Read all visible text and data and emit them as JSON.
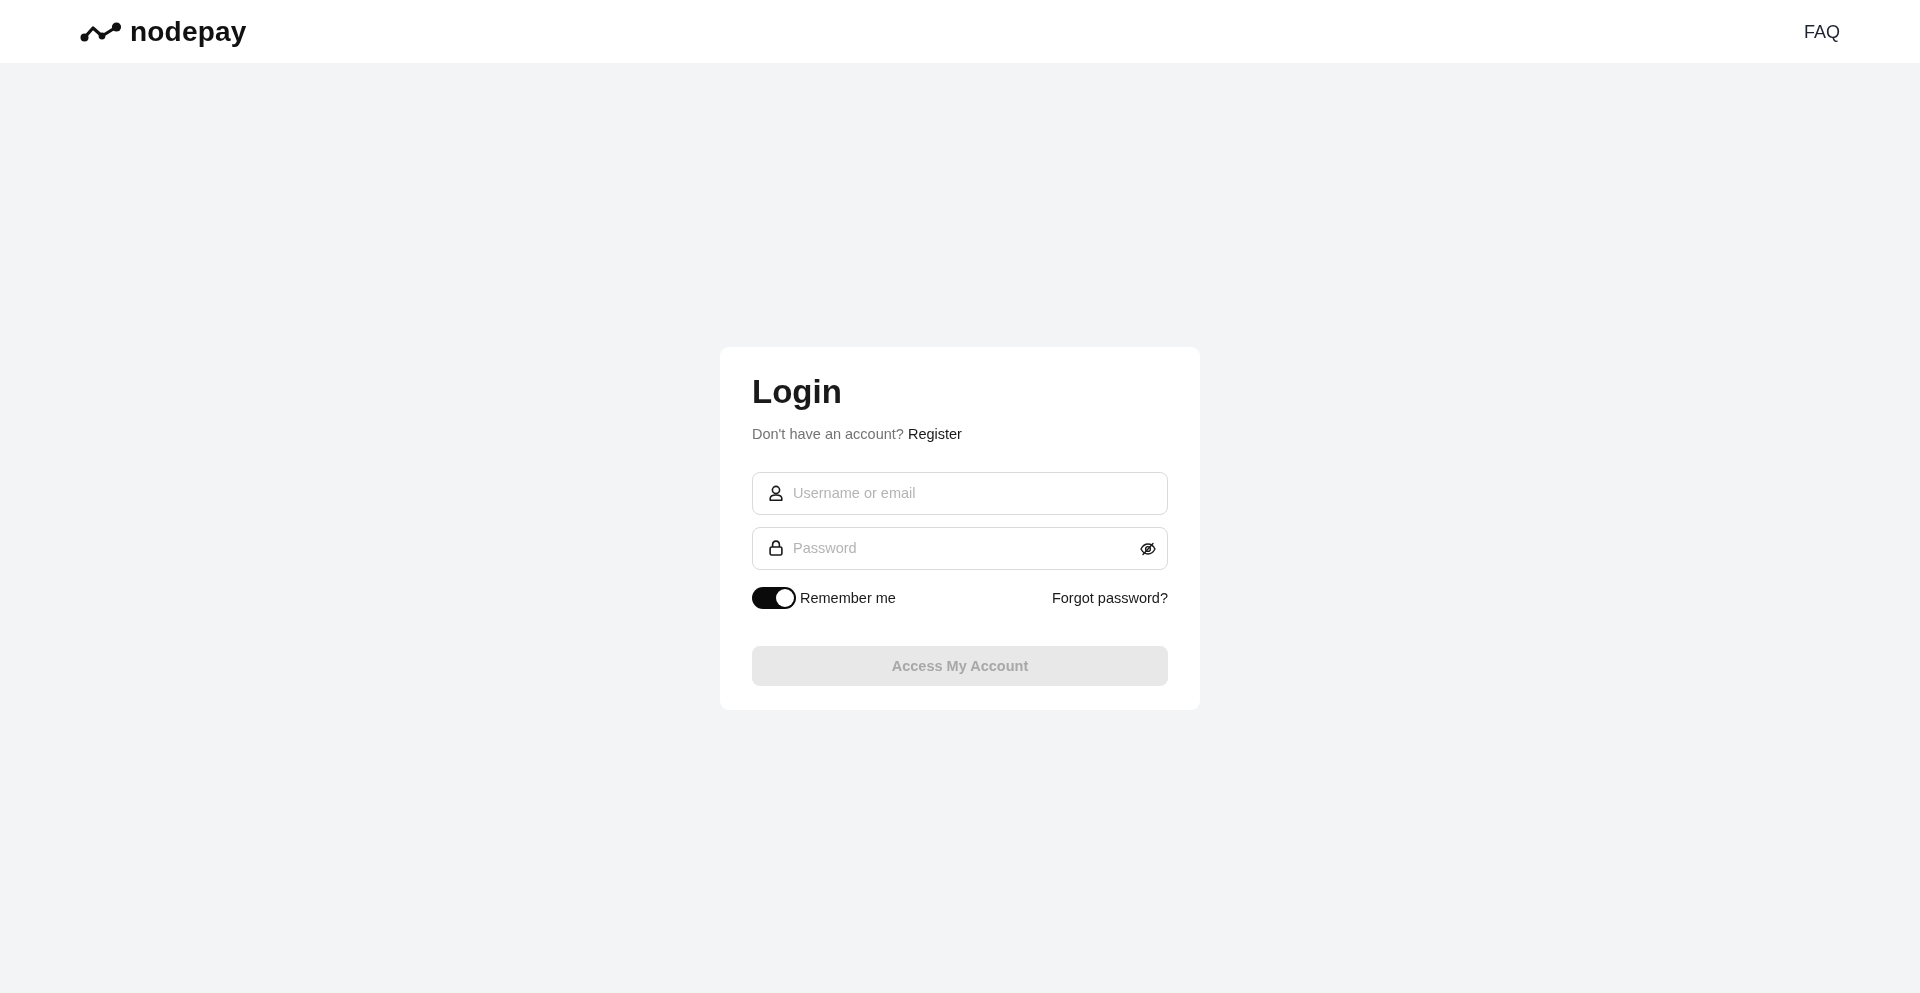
{
  "header": {
    "logo": {
      "text": "nodepay"
    },
    "nav": [
      {
        "label": "FAQ"
      }
    ]
  },
  "login": {
    "title": "Login",
    "prompt": "Don't have an account?",
    "register_link": "Register",
    "fields": [
      {
        "kind": "text",
        "placeholder": "Username or email"
      },
      {
        "kind": "password",
        "placeholder": "Password"
      }
    ],
    "remember": {
      "label": "Remember me",
      "on": true
    },
    "forgot_link": "Forgot password?",
    "submit": {
      "label": "Access My Account",
      "disabled": true
    }
  }
}
